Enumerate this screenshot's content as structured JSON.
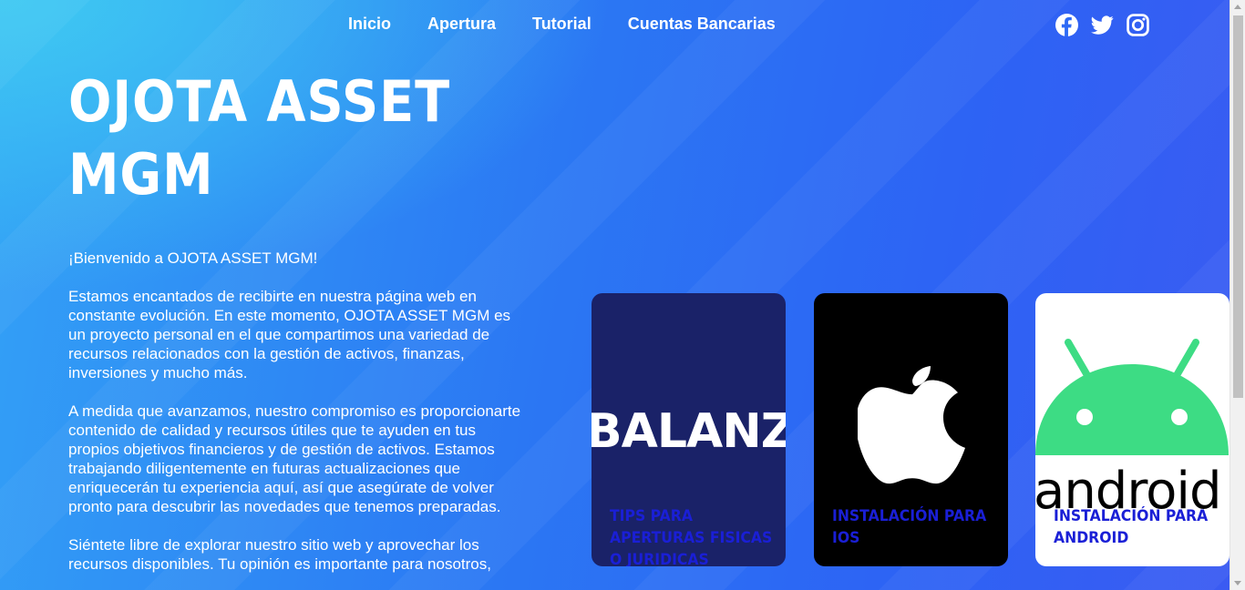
{
  "nav": {
    "items": [
      "Inicio",
      "Apertura",
      "Tutorial",
      "Cuentas Bancarias"
    ]
  },
  "social": [
    "facebook-icon",
    "twitter-icon",
    "instagram-icon"
  ],
  "hero": {
    "title_line1": "OJOTA ASSET",
    "title_line2": "MGM"
  },
  "intro": {
    "p1": "¡Bienvenido a OJOTA ASSET MGM!",
    "p2": "Estamos encantados de recibirte en nuestra página web en constante evolución. En este momento, OJOTA ASSET MGM es un proyecto personal en el que compartimos una variedad de recursos relacionados con la gestión de activos, finanzas, inversiones y mucho más.",
    "p3": "A medida que avanzamos, nuestro compromiso es proporcionarte contenido de calidad y recursos útiles que te ayuden en tus propios objetivos financieros y de gestión de activos. Estamos trabajando diligentemente en futuras actualizaciones que enriquecerán tu experiencia aquí, así que asegúrate de volver pronto para descubrir las novedades que tenemos preparadas.",
    "p4": "Siéntete libre de explorar nuestro sitio web y aprovechar los recursos disponibles. Tu opinión es importante para nosotros,"
  },
  "cards": [
    {
      "logo_text": "BALANZ",
      "label": "TIPS PARA APERTURAS FISICAS O JURIDICAS"
    },
    {
      "logo": "apple-logo",
      "label": "INSTALACIÓN PARA IOS"
    },
    {
      "logo_text": "android",
      "label": "INSTALACIÓN PARA ANDROID"
    }
  ],
  "colors": {
    "card_label": "#1a1fd6",
    "balanz_bg": "#1a2268",
    "android_green": "#3ddc84"
  }
}
